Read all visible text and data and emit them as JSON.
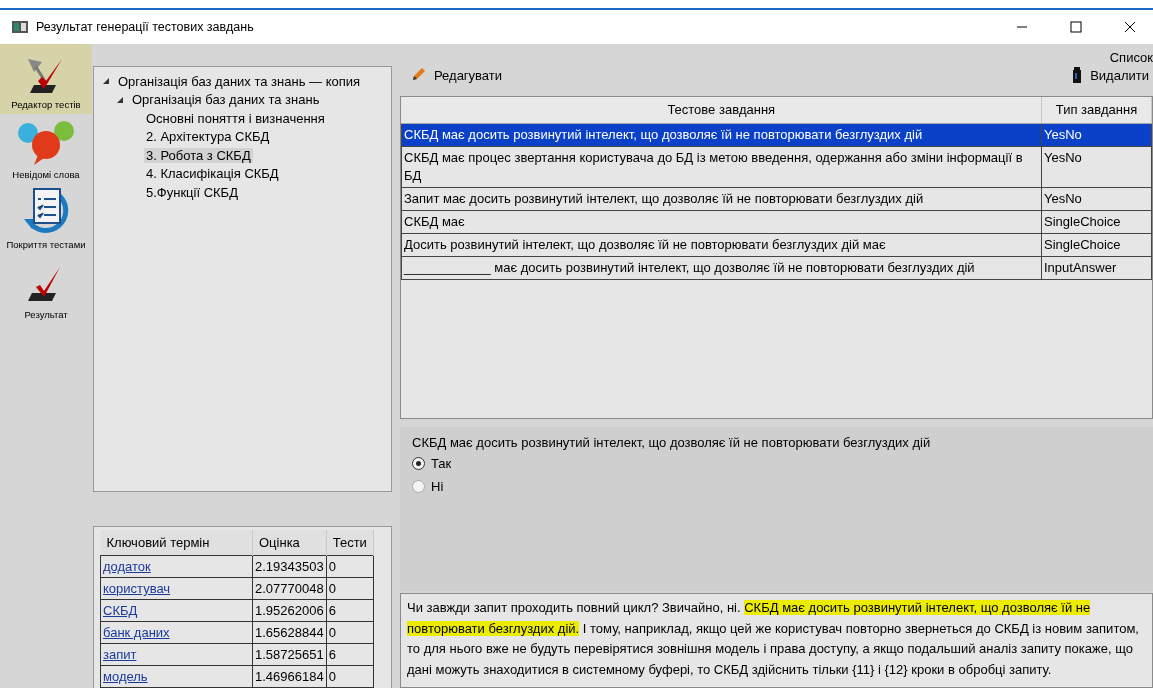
{
  "window": {
    "title": "Результат генерації тестових завдань"
  },
  "sidebar": {
    "items": [
      {
        "label": "Редактор тестів",
        "kind": "editor",
        "selected": true
      },
      {
        "label": "Невідомі слова",
        "kind": "questions",
        "selected": false
      },
      {
        "label": "Покриття тестами",
        "kind": "coverage",
        "selected": false
      },
      {
        "label": "Результат",
        "kind": "result",
        "selected": false
      }
    ]
  },
  "tree": [
    {
      "label": "Організація баз даних та знань — копия",
      "expanded": true,
      "selected": false,
      "children": [
        {
          "label": "Організація баз даних та знань",
          "expanded": true,
          "selected": false,
          "children": [
            {
              "label": "Основні поняття і визначення",
              "selected": false
            },
            {
              "label": "2. Архітектура СКБД",
              "selected": false
            },
            {
              "label": "3. Робота з СКБД",
              "selected": true
            },
            {
              "label": "4. Класифікація СКБД",
              "selected": false
            },
            {
              "label": "5.Функції СКБД",
              "selected": false
            }
          ]
        }
      ]
    }
  ],
  "keywords": {
    "columns": [
      "Ключовий термін",
      "Оцінка",
      "Тести"
    ],
    "rows": [
      {
        "term": "додаток",
        "score": "2.19343503",
        "tests": "0"
      },
      {
        "term": "користувач",
        "score": "2.07770048",
        "tests": "0"
      },
      {
        "term": "СКБД",
        "score": "1.95262006",
        "tests": "6"
      },
      {
        "term": "банк даних",
        "score": "1.65628844",
        "tests": "0"
      },
      {
        "term": "запит",
        "score": "1.58725651",
        "tests": "6"
      },
      {
        "term": "модель",
        "score": "1.46966184",
        "tests": "0"
      }
    ]
  },
  "toolbar": {
    "list_label": "Список",
    "edit": "Редагувати",
    "delete": "Видалити"
  },
  "tasks": {
    "columns": [
      "Тестове завдання",
      "Тип завдання"
    ],
    "rows": [
      {
        "task": "СКБД має досить розвинутий інтелект, що дозволяє їй не повторювати безглуздих дій",
        "type": "YesNo",
        "selected": true
      },
      {
        "task": "СКБД має процес звертання користувача до БД із метою введення, одержання або зміни інформації в БД",
        "type": "YesNo",
        "selected": false
      },
      {
        "task": "Запит має досить розвинутий інтелект, що дозволяє їй не повторювати безглуздих дій",
        "type": "YesNo",
        "selected": false
      },
      {
        "task": "СКБД має",
        "type": "SingleChoice",
        "selected": false
      },
      {
        "task": "Досить розвинутий інтелект, що дозволяє їй не повторювати безглуздих дій має",
        "type": "SingleChoice",
        "selected": false
      },
      {
        "task": "____________ має досить розвинутий інтелект, що дозволяє їй не повторювати безглуздих дій",
        "type": "InputAnswer",
        "selected": false
      }
    ]
  },
  "question": {
    "text": "СКБД має досить розвинутий інтелект, що дозволяє їй не повторювати безглуздих дій",
    "options": [
      {
        "label": "Так",
        "selected": true
      },
      {
        "label": "Ні",
        "selected": false
      }
    ]
  },
  "passage": [
    {
      "text": "Чи завжди запит проходить повний цикл? Звичайно, ні. ",
      "highlighted": false
    },
    {
      "text": "СКБД має досить розвинутий інтелект, що дозволяє їй не повторювати безглуздих дій.",
      "highlighted": true
    },
    {
      "text": " І тому, наприклад, якщо цей же користувач повторно звернеться до СКБД із новим запитом, то для нього вже не будуть перевірятися зовнішня модель і права доступу, а якщо подальший аналіз запиту покаже, що дані можуть знаходитися в системному буфері, то СКБД здійснить тільки {11} і {12} кроки в обробці запиту.",
      "highlighted": false
    }
  ]
}
